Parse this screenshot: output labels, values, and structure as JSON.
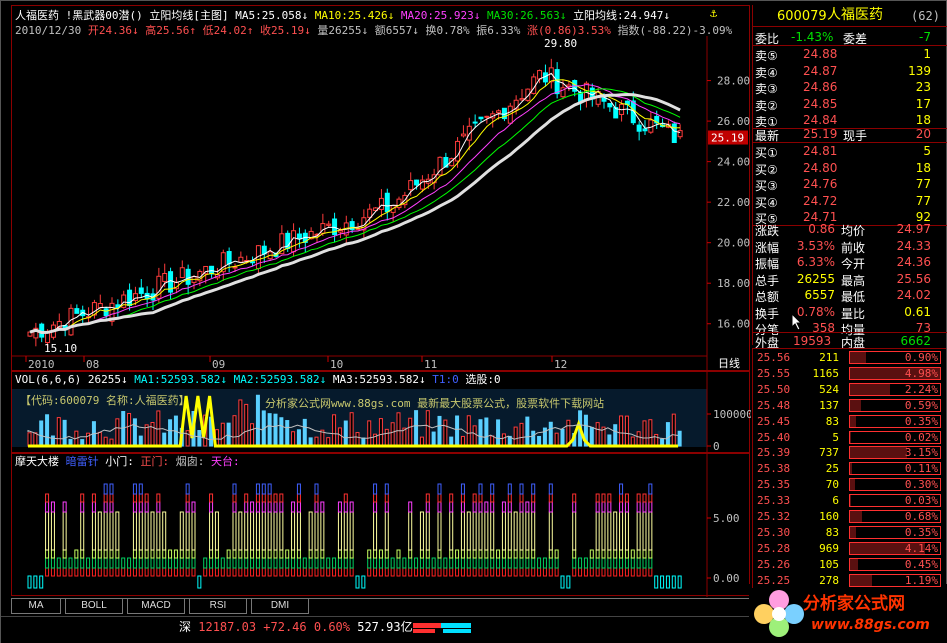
{
  "stock": {
    "name": "人福医药",
    "code": "600079",
    "code_badge": "62"
  },
  "chart": {
    "toolbar_title": "人福医药",
    "formula": "!黑武器00潜()",
    "mode": "立阳均线[主图]",
    "ma5": "MA5:25.058↓",
    "ma10": "MA10:25.426↓",
    "ma20": "MA20:25.923↓",
    "ma30": "MA30:26.563↓",
    "ma_extra": "立阳均线:24.947↓",
    "info_date": "2010/12/30",
    "info_open": "开24.36↓",
    "info_high": "高25.56↑",
    "info_low": "低24.02↑",
    "info_close": "收25.19↓",
    "info_vol": "量26255↓",
    "info_amt": "额6557↓",
    "info_turn": "换0.78%",
    "info_amp": "振6.33%",
    "info_chg": "涨(0.86)3.53%",
    "info_index": "指数(-88.22)-3.09%",
    "high_mark": "29.80",
    "low_mark": "15.10",
    "price_ticks": [
      "28.00",
      "26.00",
      "24.00",
      "22.00",
      "20.00",
      "18.00",
      "16.00"
    ],
    "current_price_tag": "25.19",
    "months": [
      "2010",
      "08",
      "09",
      "10",
      "11",
      "12"
    ],
    "period_label": "日线"
  },
  "volume": {
    "title": "VOL(6,6,6)",
    "value": "26255↓",
    "ma1": "MA1:52593.582↓",
    "ma2": "MA2:52593.582↓",
    "ma3": "MA3:52593.582↓",
    "t1": "T1:0",
    "select": "选股:0",
    "watermark_code": "【代码:600079 名称:人福医药】",
    "watermark_site": "分析家公式网www.88gs.com  最新最大股票公式，股票软件下载网站",
    "ticks": [
      "100000",
      "0"
    ]
  },
  "indicator": {
    "title": "摩天大楼",
    "l1": "暗雷针",
    "l2": "小门:",
    "l3": "正门:",
    "l4": "烟囱:",
    "l5": "天台:",
    "ticks": [
      "5.00",
      "0.00"
    ]
  },
  "tabs": [
    "MA",
    "BOLL",
    "MACD",
    "RSI",
    "DMI"
  ],
  "status": {
    "market": "深",
    "index": "12187.03",
    "change": "+72.46",
    "pct": "0.60%",
    "amount": "527.93亿"
  },
  "quote": {
    "wb_label": "委比",
    "wb_val": "-1.43%",
    "wc_label": "委差",
    "wc_val": "-7",
    "asks": [
      {
        "label": "卖⑤",
        "price": "24.88",
        "vol": "1"
      },
      {
        "label": "卖④",
        "price": "24.87",
        "vol": "139"
      },
      {
        "label": "卖③",
        "price": "24.86",
        "vol": "23"
      },
      {
        "label": "卖②",
        "price": "24.85",
        "vol": "17"
      },
      {
        "label": "卖①",
        "price": "24.84",
        "vol": "18"
      }
    ],
    "last_label": "最新",
    "last_val": "25.19",
    "hand_label": "现手",
    "hand_val": "20",
    "bids": [
      {
        "label": "买①",
        "price": "24.81",
        "vol": "5"
      },
      {
        "label": "买②",
        "price": "24.80",
        "vol": "18"
      },
      {
        "label": "买③",
        "price": "24.76",
        "vol": "77"
      },
      {
        "label": "买④",
        "price": "24.72",
        "vol": "77"
      },
      {
        "label": "买⑤",
        "price": "24.71",
        "vol": "92"
      }
    ],
    "stats": [
      {
        "l1": "涨跌",
        "v1": "0.86",
        "l2": "均价",
        "v2": "24.97"
      },
      {
        "l1": "涨幅",
        "v1": "3.53%",
        "l2": "前收",
        "v2": "24.33"
      },
      {
        "l1": "振幅",
        "v1": "6.33%",
        "l2": "今开",
        "v2": "24.36"
      },
      {
        "l1": "总手",
        "v1": "26255",
        "l2": "最高",
        "v2": "25.56"
      },
      {
        "l1": "总额",
        "v1": "6557",
        "l2": "最低",
        "v2": "24.02"
      },
      {
        "l1": "换手",
        "v1": "0.78%",
        "l2": "量比",
        "v2": "0.61"
      },
      {
        "l1": "分笔",
        "v1": "358",
        "l2": "均量",
        "v2": "73"
      }
    ],
    "outer_label": "外盘",
    "outer_val": "19593",
    "inner_label": "内盘",
    "inner_val": "6662"
  },
  "levels": [
    {
      "p": "25.56",
      "v": "211",
      "pct": "0.90%"
    },
    {
      "p": "25.55",
      "v": "1165",
      "pct": "4.98%"
    },
    {
      "p": "25.50",
      "v": "524",
      "pct": "2.24%"
    },
    {
      "p": "25.48",
      "v": "137",
      "pct": "0.59%"
    },
    {
      "p": "25.45",
      "v": "83",
      "pct": "0.35%"
    },
    {
      "p": "25.40",
      "v": "5",
      "pct": "0.02%"
    },
    {
      "p": "25.39",
      "v": "737",
      "pct": "3.15%"
    },
    {
      "p": "25.38",
      "v": "25",
      "pct": "0.11%"
    },
    {
      "p": "25.35",
      "v": "70",
      "pct": "0.30%"
    },
    {
      "p": "25.33",
      "v": "6",
      "pct": "0.03%"
    },
    {
      "p": "25.32",
      "v": "160",
      "pct": "0.68%"
    },
    {
      "p": "25.30",
      "v": "83",
      "pct": "0.35%"
    },
    {
      "p": "25.28",
      "v": "969",
      "pct": "4.14%"
    },
    {
      "p": "25.26",
      "v": "105",
      "pct": "0.45%"
    },
    {
      "p": "25.25",
      "v": "278",
      "pct": "1.19%"
    }
  ],
  "logo": {
    "text": "分析家公式网",
    "url": "www.88gs.com"
  },
  "colors": {
    "up": "#ff3c3c",
    "down": "#00ffff",
    "bg": "#000000",
    "grid": "#8b0000",
    "ma5": "#ffffff",
    "ma10": "#ffff00",
    "ma20": "#ff40ff",
    "ma30": "#00ff00",
    "stripe": "#2a2a2a"
  }
}
